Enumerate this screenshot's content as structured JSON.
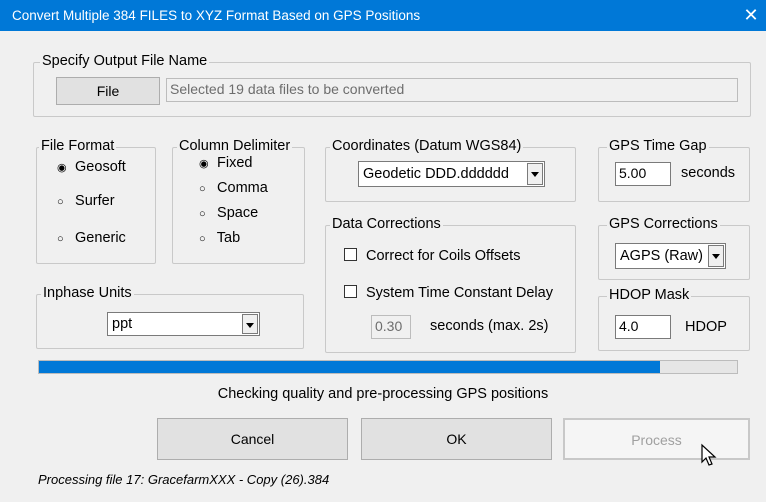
{
  "window": {
    "title": "Convert Multiple 384 FILES to XYZ Format Based on GPS Positions",
    "close_glyph": "✕"
  },
  "output": {
    "legend": "Specify Output File Name",
    "file_button": "File",
    "file_field": "Selected 19 data files to be converted"
  },
  "file_format": {
    "legend": "File Format",
    "options": [
      "Geosoft",
      "Surfer",
      "Generic"
    ],
    "selected": "Geosoft"
  },
  "column_delimiter": {
    "legend": "Column Delimiter",
    "options": [
      "Fixed",
      "Comma",
      "Space",
      "Tab"
    ],
    "selected": "Fixed"
  },
  "coordinates": {
    "legend": "Coordinates (Datum WGS84)",
    "value": "Geodetic DDD.dddddd"
  },
  "gps_time_gap": {
    "legend": "GPS Time Gap",
    "value": "5.00",
    "unit": "seconds"
  },
  "inphase_units": {
    "legend": "Inphase Units",
    "value": "ppt"
  },
  "data_corrections": {
    "legend": "Data Corrections",
    "coils_offsets": {
      "label": "Correct for Coils Offsets",
      "checked": false
    },
    "time_constant": {
      "label": "System Time Constant Delay",
      "checked": false
    },
    "delay_value": "0.30",
    "delay_unit": "seconds (max. 2s)"
  },
  "gps_corrections": {
    "legend": "GPS Corrections",
    "value": "AGPS (Raw)"
  },
  "hdop_mask": {
    "legend": "HDOP Mask",
    "value": "4.0",
    "unit": "HDOP"
  },
  "progress": {
    "percent": 89,
    "color": "#0078d7",
    "status": "Checking quality and pre-processing GPS positions"
  },
  "buttons": {
    "cancel": "Cancel",
    "ok": "OK",
    "process": "Process"
  },
  "footer": {
    "status": "Processing file 17: GracefarmXXX - Copy (26).384"
  },
  "colors": {
    "titlebar": "#0078d7",
    "background": "#f0f0f0"
  }
}
